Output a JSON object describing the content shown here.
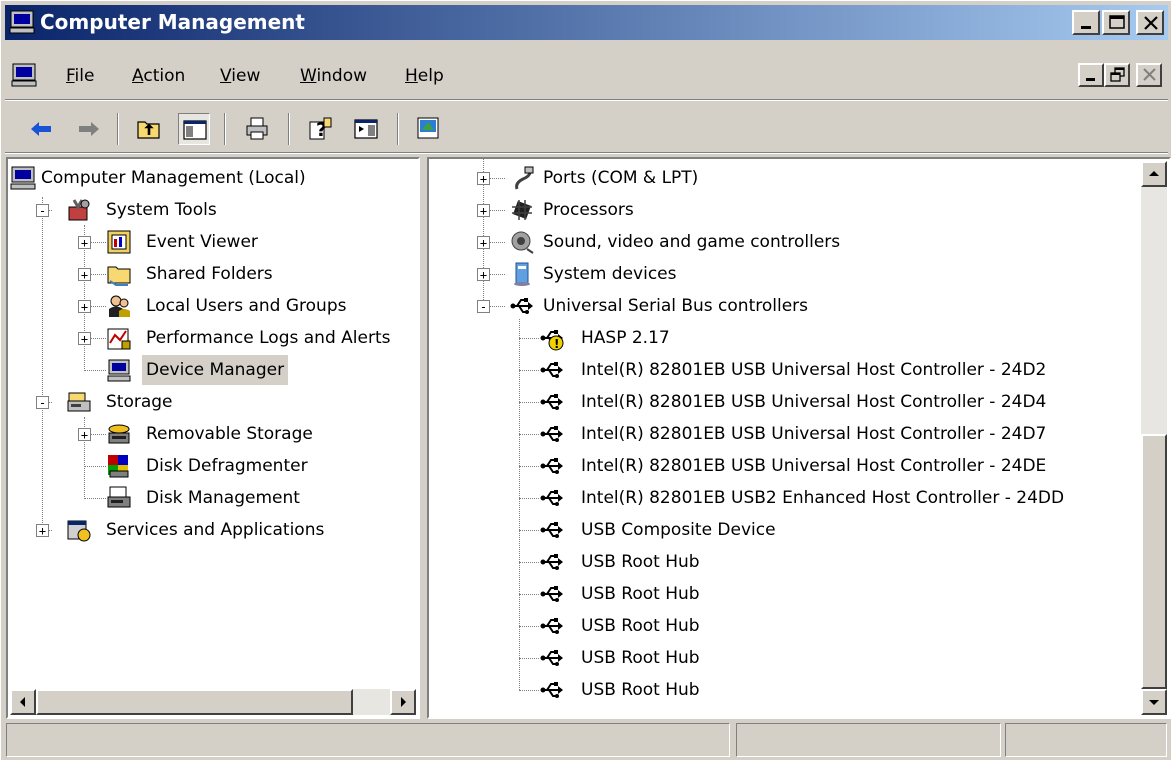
{
  "window": {
    "title": "Computer Management",
    "buttons": [
      "minimize",
      "maximize",
      "close"
    ]
  },
  "menubar": {
    "items": [
      {
        "underline": "F",
        "rest": "ile"
      },
      {
        "underline": "A",
        "rest": "ction"
      },
      {
        "underline": "V",
        "rest": "iew"
      },
      {
        "underline": "W",
        "rest": "indow"
      },
      {
        "underline": "H",
        "rest": "elp"
      }
    ]
  },
  "toolbar": {
    "icons": [
      "back-arrow-icon",
      "forward-arrow-icon",
      "up-folder-icon",
      "show-hide-tree-icon",
      "print-icon",
      "help-icon",
      "show-hide-action-pane-icon",
      "properties-icon"
    ]
  },
  "tree": {
    "root": "Computer Management (Local)",
    "system_tools": "System Tools",
    "event_viewer": "Event Viewer",
    "shared_folders": "Shared Folders",
    "local_users": "Local Users and Groups",
    "perf_logs": "Performance Logs and Alerts",
    "device_manager": "Device Manager",
    "storage": "Storage",
    "removable_storage": "Removable Storage",
    "disk_defrag": "Disk Defragmenter",
    "disk_management": "Disk Management",
    "services_apps": "Services and Applications"
  },
  "devices": {
    "ports": "Ports (COM & LPT)",
    "processors": "Processors",
    "sound": "Sound, video and game controllers",
    "system_devices": "System devices",
    "usb_controllers": "Universal Serial Bus controllers",
    "usb_children": [
      "HASP 2.17",
      "Intel(R) 82801EB USB Universal Host Controller - 24D2",
      "Intel(R) 82801EB USB Universal Host Controller - 24D4",
      "Intel(R) 82801EB USB Universal Host Controller - 24D7",
      "Intel(R) 82801EB USB Universal Host Controller - 24DE",
      "Intel(R) 82801EB USB2 Enhanced Host Controller - 24DD",
      "USB Composite Device",
      "USB Root Hub",
      "USB Root Hub",
      "USB Root Hub",
      "USB Root Hub",
      "USB Root Hub"
    ]
  },
  "statusbar": {
    "panels": [
      "",
      "",
      ""
    ]
  }
}
